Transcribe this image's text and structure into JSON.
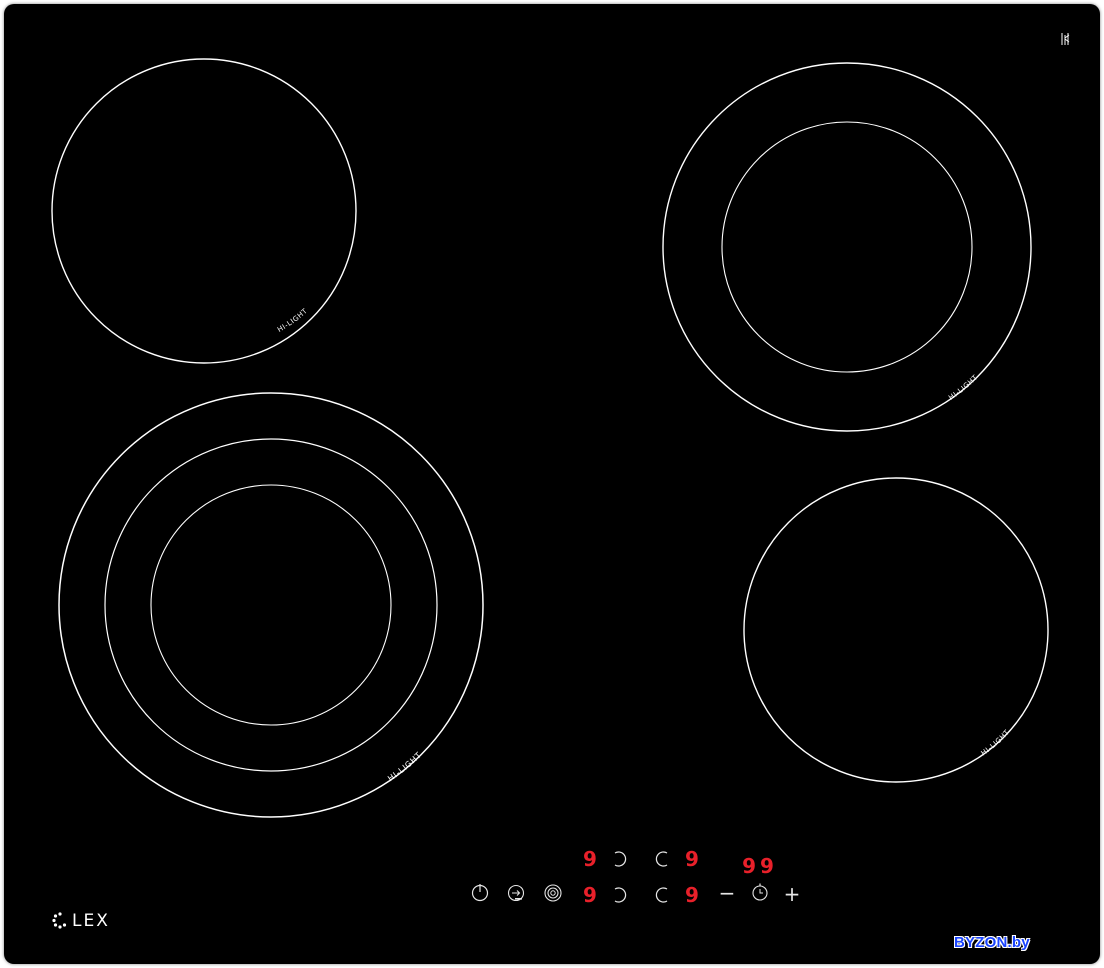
{
  "zones": [
    {
      "id": "rear-left",
      "label": "HI-LIGHT",
      "ring_count": 1
    },
    {
      "id": "rear-right",
      "label": "HI-LIGHT",
      "ring_count": 2
    },
    {
      "id": "front-left",
      "label": "HI-LIGHT",
      "ring_count": 3
    },
    {
      "id": "front-right",
      "label": "HI-LIGHT",
      "ring_count": 1
    }
  ],
  "displays": {
    "rear_left_level": "9",
    "rear_right_level": "9",
    "front_left_level": "9",
    "front_right_level": "9",
    "timer_value": "99"
  },
  "controls": {
    "minus_symbol": "−",
    "plus_symbol": "+"
  },
  "brand": {
    "name": "LEX"
  },
  "watermark": "BYZON.by",
  "colors": {
    "panel": "#000000",
    "print": "#ffffff",
    "led": "#e8202a",
    "watermark": "#1a44ff"
  },
  "icons": [
    "power-icon",
    "lock-icon",
    "extension-zone-icon",
    "zone-select-icon",
    "timer-icon",
    "hot-surface-icon",
    "lex-logo-icon"
  ]
}
